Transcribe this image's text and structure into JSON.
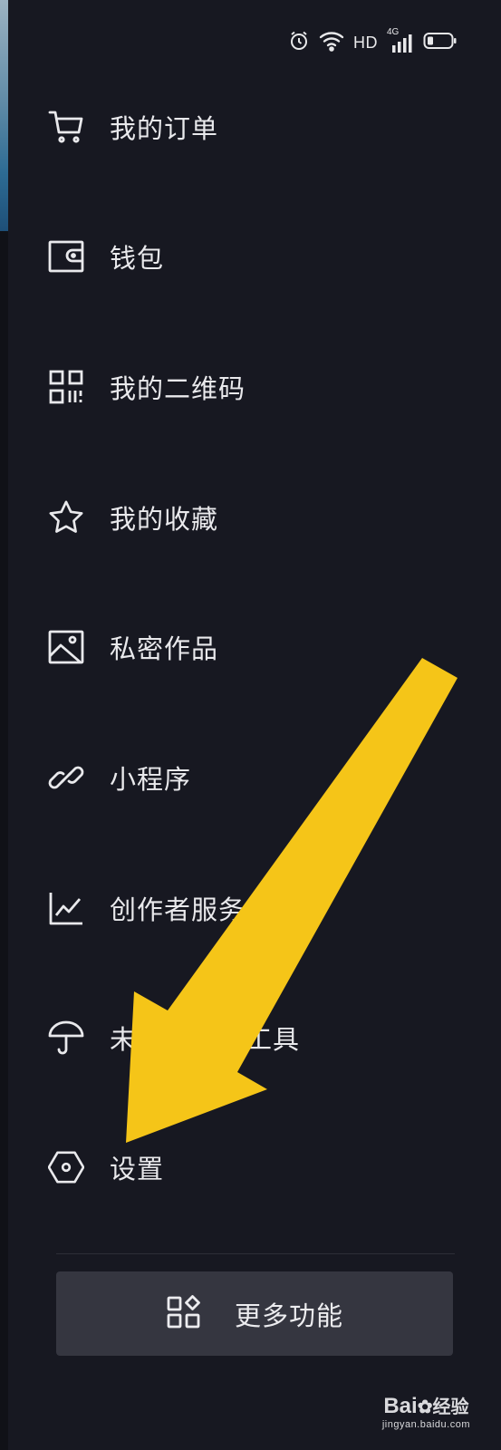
{
  "status_bar": {
    "network_label": "HD",
    "signal_label": "4G",
    "icons": [
      "alarm-icon",
      "wifi-icon",
      "signal-icon",
      "battery-icon"
    ]
  },
  "menu": {
    "items": [
      {
        "id": "orders",
        "label": "我的订单",
        "icon": "cart-icon"
      },
      {
        "id": "wallet",
        "label": "钱包",
        "icon": "wallet-icon"
      },
      {
        "id": "qrcode",
        "label": "我的二维码",
        "icon": "qrcode-icon"
      },
      {
        "id": "favorites",
        "label": "我的收藏",
        "icon": "star-icon"
      },
      {
        "id": "private-works",
        "label": "私密作品",
        "icon": "image-icon"
      },
      {
        "id": "mini-programs",
        "label": "小程序",
        "icon": "link-icon"
      },
      {
        "id": "creator-center",
        "label": "创作者服务中心",
        "icon": "chart-icon"
      },
      {
        "id": "minor-protection",
        "label": "未成年保护工具",
        "icon": "umbrella-icon"
      },
      {
        "id": "settings",
        "label": "设置",
        "icon": "hexagon-settings-icon"
      }
    ]
  },
  "more_button": {
    "label": "更多功能",
    "icon": "apps-icon"
  },
  "annotation": {
    "color": "#f5c518",
    "points_to": "settings"
  },
  "watermark": {
    "main": "Bai",
    "main2": "经验",
    "sub": "jingyan.baidu.com"
  },
  "colors": {
    "background": "#171821",
    "text": "#e9e9ec",
    "button_bg": "#353640",
    "arrow": "#f5c518"
  }
}
